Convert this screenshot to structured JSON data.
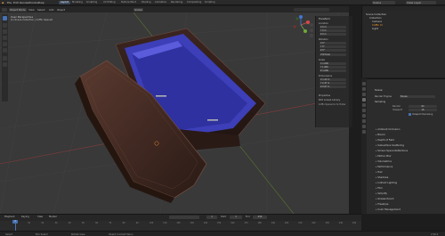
{
  "menu": [
    "File",
    "Edit",
    "Render",
    "Window",
    "Help"
  ],
  "workspace_tabs": [
    "Layout",
    "Modeling",
    "Sculpting",
    "UV Editing",
    "Texture Paint",
    "Shading",
    "Animation",
    "Rendering",
    "Compositing",
    "Scripting"
  ],
  "active_tab": "Layout",
  "scene": {
    "scene_name": "Scene",
    "view_layer": "View Layer"
  },
  "viewport_header": {
    "mode": "Object Mode",
    "items": [
      "View",
      "Select",
      "Add",
      "Object"
    ],
    "shading": "Global"
  },
  "viewport_overlay": {
    "title": "User Perspective",
    "subtitle": "(1) Scene Collection | Coffin Opened"
  },
  "transform_panel": {
    "header": "Transform",
    "location": "Location",
    "loc_x": "X   0 m",
    "loc_y": "Y   0 m",
    "loc_z": "Z   0 m",
    "rotation": "Rotation",
    "rot_x": "X   0°",
    "rot_y": "Y   0°",
    "rot_z": "Z   0°",
    "rot_mode": "XYZ Euler",
    "scale": "Scale",
    "scale_x": "X   1.000",
    "scale_y": "Y   1.000",
    "scale_z": "Z   1.000",
    "dimensions": "Dimensions",
    "dim_x": "X   1.22 m",
    "dim_y": "Y   2.47 m",
    "dim_z": "Z   0.67 m",
    "properties": "Properties",
    "library": "Edit Linked Library",
    "library_item": "Coffin Opened in Sc Hinter"
  },
  "outliner": {
    "title": "Scene Collection",
    "items": [
      "Collection",
      "Camera",
      "Coffin Cl",
      "Light"
    ]
  },
  "properties": {
    "panel_title": "Scene",
    "render_engine_label": "Render Engine",
    "render_engine": "Eevee",
    "sampling": "Sampling",
    "render_label": "Render",
    "render_value": "64",
    "viewport_label": "Viewport",
    "viewport_value": "16",
    "viewport_denoise": "Viewport Denoising",
    "sections": [
      "Ambient Occlusion",
      "Bloom",
      "Depth of Field",
      "Subsurface Scattering",
      "Screen Space Reflections",
      "Motion Blur",
      "Volumetrics",
      "Performance",
      "Hair",
      "Shadows",
      "Indirect Lighting",
      "Film",
      "Simplify",
      "Grease Pencil",
      "Freestyle",
      "Color Management"
    ]
  },
  "timeline": {
    "menu": [
      "Playback",
      "Keying",
      "View",
      "Marker"
    ],
    "current_frame": "1",
    "start_label": "Start",
    "start": "1",
    "end_label": "End",
    "end": "250",
    "ticks": [
      "0",
      "10",
      "20",
      "30",
      "40",
      "50",
      "60",
      "70",
      "80",
      "90",
      "100",
      "110",
      "120",
      "130",
      "140",
      "150",
      "160",
      "170",
      "180",
      "190",
      "200",
      "210",
      "220",
      "230",
      "240",
      "250"
    ]
  },
  "statusbar": {
    "select": "Select",
    "box_select": "Box Select",
    "rotate_view": "Rotate View",
    "context_menu": "Object Context Menu",
    "version": "2.90.0"
  },
  "colors": {
    "accent": "#4772b3",
    "coffin_wood": "#4a2f27",
    "coffin_interior": "#3d3fb8",
    "x_axis": "#d44a4a",
    "y_axis": "#6eaa3a",
    "z_axis": "#3f78d6"
  }
}
